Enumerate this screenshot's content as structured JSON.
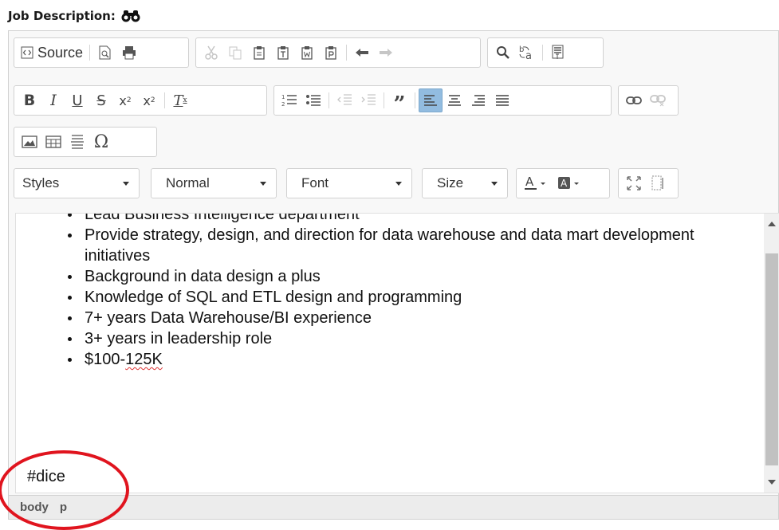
{
  "field": {
    "label": "Job Description:",
    "icon": "binoculars-icon"
  },
  "toolbar": {
    "source_label": "Source",
    "styles_label": "Styles",
    "format_label": "Normal",
    "font_label": "Font",
    "size_label": "Size",
    "active_button": "align-left",
    "accent_color": "#92bce0"
  },
  "content": {
    "bullets": [
      "Lead Business Intelligence department",
      "Provide strategy, design, and direction for data warehouse and data mart development initiatives",
      "Background in data design a plus",
      "Knowledge of SQL and ETL design and programming",
      "7+ years Data Warehouse/BI experience",
      "3+ years in leadership role"
    ],
    "last_bullet_prefix": "$100-",
    "last_bullet_squiggle": "125K",
    "tag_line": "#dice"
  },
  "statusbar": {
    "path_1": "body",
    "path_2": "p"
  },
  "annotation": {
    "color": "#e0141e"
  }
}
